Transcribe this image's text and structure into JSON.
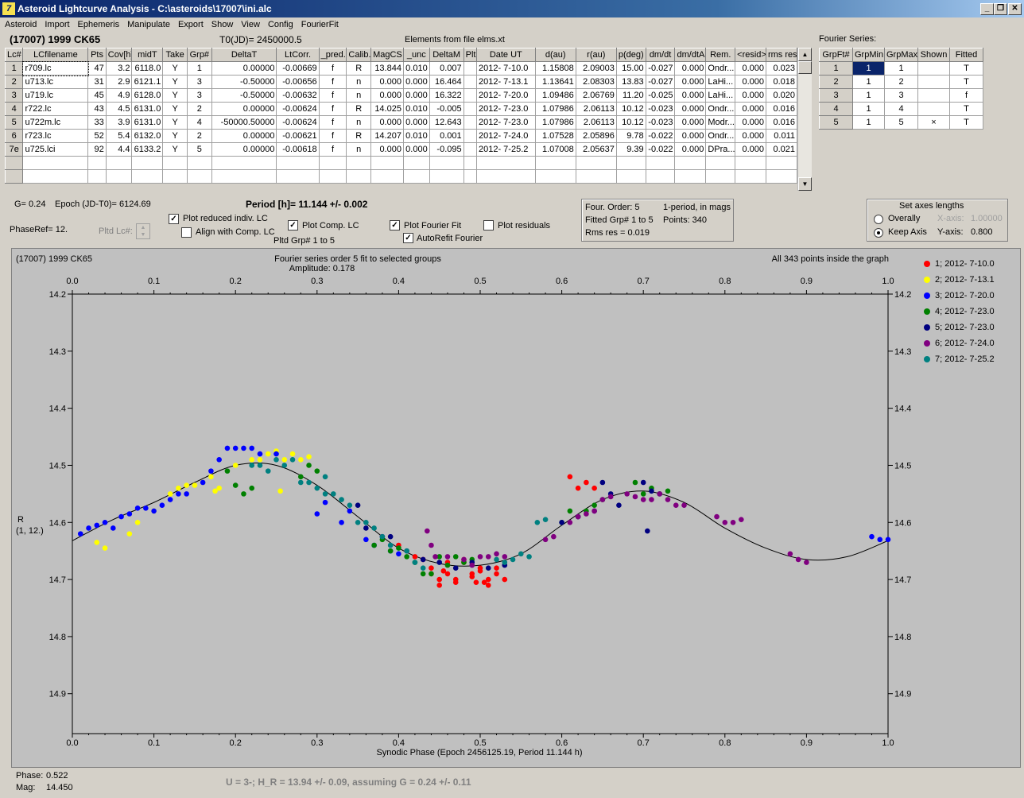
{
  "window": {
    "title": "Asteroid Lightcurve Analysis - C:\\asteroids\\17007\\ini.alc",
    "icon_name": "app-logo-icon",
    "buttons": {
      "minimize": "_",
      "restore": "❐",
      "close": "✕"
    }
  },
  "menu": [
    "Asteroid",
    "Import",
    "Ephemeris",
    "Manipulate",
    "Export",
    "Show",
    "View",
    "Config",
    "FourierFit"
  ],
  "header": {
    "asteroid": "(17007) 1999 CK65",
    "t0": "T0(JD)= 2450000.5",
    "elements": "Elements from file elms.xt",
    "fourier_series_label": "Fourier Series:"
  },
  "lc_table": {
    "columns": [
      "Lc#",
      "LCfilename",
      "Pts",
      "Cov[h]",
      "midT",
      "Take",
      "Grp#",
      "DeltaT",
      "LtCorr.",
      "_pred.",
      "Calib.",
      "MagCS",
      "_unc",
      "DeltaM",
      "Plt",
      "Date UT",
      "d(au)",
      "r(au)",
      "p(deg)",
      "dm/dt",
      "dm/dtA",
      "Rem.",
      "<resid>",
      "rms res"
    ],
    "rows": [
      [
        "1",
        "r709.lc",
        "47",
        "3.2",
        "6118.0",
        "Y",
        "1",
        "0.00000",
        "-0.00669",
        "f",
        "R",
        "13.844",
        "0.010",
        "0.007",
        "",
        "2012- 7-10.0",
        "1.15808",
        "2.09003",
        "15.00",
        "-0.027",
        "0.000",
        "Ondr...",
        "0.000",
        "0.023"
      ],
      [
        "2",
        "u713.lc",
        "31",
        "2.9",
        "6121.1",
        "Y",
        "3",
        "-0.50000",
        "-0.00656",
        "f",
        "n",
        "0.000",
        "0.000",
        "16.464",
        "",
        "2012- 7-13.1",
        "1.13641",
        "2.08303",
        "13.83",
        "-0.027",
        "0.000",
        "LaHi...",
        "0.000",
        "0.018"
      ],
      [
        "3",
        "u719.lc",
        "45",
        "4.9",
        "6128.0",
        "Y",
        "3",
        "-0.50000",
        "-0.00632",
        "f",
        "n",
        "0.000",
        "0.000",
        "16.322",
        "",
        "2012- 7-20.0",
        "1.09486",
        "2.06769",
        "11.20",
        "-0.025",
        "0.000",
        "LaHi...",
        "0.000",
        "0.020"
      ],
      [
        "4",
        "r722.lc",
        "43",
        "4.5",
        "6131.0",
        "Y",
        "2",
        "0.00000",
        "-0.00624",
        "f",
        "R",
        "14.025",
        "0.010",
        "-0.005",
        "",
        "2012- 7-23.0",
        "1.07986",
        "2.06113",
        "10.12",
        "-0.023",
        "0.000",
        "Ondr...",
        "0.000",
        "0.016"
      ],
      [
        "5",
        "u722m.lc",
        "33",
        "3.9",
        "6131.0",
        "Y",
        "4",
        "-50000.50000",
        "-0.00624",
        "f",
        "n",
        "0.000",
        "0.000",
        "12.643",
        "",
        "2012- 7-23.0",
        "1.07986",
        "2.06113",
        "10.12",
        "-0.023",
        "0.000",
        "Modr...",
        "0.000",
        "0.016"
      ],
      [
        "6",
        "r723.lc",
        "52",
        "5.4",
        "6132.0",
        "Y",
        "2",
        "0.00000",
        "-0.00621",
        "f",
        "R",
        "14.207",
        "0.010",
        "0.001",
        "",
        "2012- 7-24.0",
        "1.07528",
        "2.05896",
        "9.78",
        "-0.022",
        "0.000",
        "Ondr...",
        "0.000",
        "0.011"
      ],
      [
        "7e",
        "u725.lci",
        "92",
        "4.4",
        "6133.2",
        "Y",
        "5",
        "0.00000",
        "-0.00618",
        "f",
        "n",
        "0.000",
        "0.000",
        "-0.095",
        "",
        "2012- 7-25.2",
        "1.07008",
        "2.05637",
        "9.39",
        "-0.022",
        "0.000",
        "DPra...",
        "0.000",
        "0.021"
      ]
    ]
  },
  "fourier_table": {
    "columns": [
      "GrpFt#",
      "GrpMin",
      "GrpMax",
      "Shown",
      "Fitted"
    ],
    "rows": [
      [
        "1",
        "1",
        "1",
        "",
        "T"
      ],
      [
        "2",
        "1",
        "2",
        "",
        "T"
      ],
      [
        "3",
        "1",
        "3",
        "",
        "f"
      ],
      [
        "4",
        "1",
        "4",
        "",
        "T"
      ],
      [
        "5",
        "1",
        "5",
        "×",
        "T"
      ]
    ]
  },
  "controls": {
    "g": "G= 0.24",
    "epoch": "Epoch (JD-T0)= 6124.69",
    "period": "Period [h]= 11.144 +/- 0.002",
    "phaseref": "PhaseRef= 12.",
    "pltd_lc": "Pltd Lc#:",
    "plot_reduced": "Plot reduced indiv. LC",
    "align_comp": "Align with Comp. LC",
    "plot_comp": "Plot Comp. LC",
    "pltd_grp": "Pltd Grp#  1   to    5",
    "plot_fourier": "Plot Fourier Fit",
    "autorefit": "AutoRefit Fourier",
    "plot_residuals": "Plot residuals",
    "four_order": "Four. Order:  5",
    "one_period": "1-period, in mags",
    "fitted_grp": "Fitted Grp# 1 to 5",
    "points": "Points: 340",
    "rms": "Rms res      = 0.019",
    "axes_title": "Set axes lengths",
    "overally": "Overally",
    "keep_axis": "Keep Axis",
    "x_axis_label": "X-axis:",
    "x_axis_value": "1.00000",
    "y_axis_label": "Y-axis:",
    "y_axis_value": "0.800",
    "checked": {
      "plot_reduced": true,
      "align_comp": false,
      "plot_comp": true,
      "plot_fourier": true,
      "autorefit": true,
      "plot_residuals": false
    },
    "axes_mode": "keep_axis"
  },
  "chart_data": {
    "type": "scatter",
    "title": "(17007) 1999 CK65",
    "subtitle": "Fourier series order 5 fit to selected groups",
    "amplitude": "Amplitude: 0.178",
    "inside": "All 343 points inside the graph",
    "xlabel": "Synodic Phase (Epoch 2456125.19, Period 11.144 h)",
    "ylabel": "R",
    "ylabel2": "(1, 12.)",
    "xlim": [
      0.0,
      1.0
    ],
    "ylim": [
      14.2,
      15.0
    ],
    "x_ticks": [
      "0.0",
      "0.1",
      "0.2",
      "0.3",
      "0.4",
      "0.5",
      "0.6",
      "0.7",
      "0.8",
      "0.9",
      "1.0"
    ],
    "y_ticks": [
      "14.2",
      "14.3",
      "14.4",
      "14.5",
      "14.6",
      "14.7",
      "14.8",
      "14.9"
    ],
    "legend_position": "right",
    "fit_curve": {
      "x": [
        0.0,
        0.05,
        0.1,
        0.15,
        0.2,
        0.25,
        0.3,
        0.35,
        0.4,
        0.45,
        0.5,
        0.55,
        0.6,
        0.65,
        0.7,
        0.75,
        0.8,
        0.85,
        0.9,
        0.95,
        1.0
      ],
      "y": [
        14.632,
        14.595,
        14.565,
        14.53,
        14.5,
        14.5,
        14.535,
        14.59,
        14.645,
        14.672,
        14.675,
        14.655,
        14.605,
        14.56,
        14.545,
        14.565,
        14.61,
        14.645,
        14.665,
        14.66,
        14.632
      ]
    },
    "series": [
      {
        "name": "1; 2012- 7-10.0",
        "color": "#ff0000",
        "x": [
          0.38,
          0.4,
          0.42,
          0.44,
          0.45,
          0.46,
          0.47,
          0.48,
          0.49,
          0.5,
          0.51,
          0.52,
          0.53,
          0.46,
          0.48,
          0.5,
          0.61,
          0.62,
          0.63,
          0.64,
          0.45,
          0.49,
          0.51,
          0.44,
          0.47,
          0.52,
          0.43,
          0.455,
          0.505,
          0.495
        ],
        "y": [
          14.625,
          14.64,
          14.66,
          14.68,
          14.71,
          14.69,
          14.7,
          14.67,
          14.69,
          14.68,
          14.71,
          14.69,
          14.7,
          14.67,
          14.665,
          14.685,
          14.52,
          14.54,
          14.53,
          14.54,
          14.7,
          14.695,
          14.7,
          14.69,
          14.705,
          14.68,
          14.665,
          14.685,
          14.705,
          14.705
        ]
      },
      {
        "name": "2; 2012- 7-13.1",
        "color": "#ffff00",
        "x": [
          0.03,
          0.04,
          0.07,
          0.12,
          0.13,
          0.14,
          0.15,
          0.16,
          0.17,
          0.18,
          0.2,
          0.22,
          0.23,
          0.24,
          0.25,
          0.26,
          0.27,
          0.28,
          0.29,
          0.1,
          0.08,
          0.175,
          0.255
        ],
        "y": [
          14.635,
          14.645,
          14.62,
          14.55,
          14.54,
          14.535,
          14.535,
          14.53,
          14.52,
          14.54,
          14.5,
          14.49,
          14.49,
          14.48,
          14.475,
          14.49,
          14.48,
          14.49,
          14.485,
          14.58,
          14.6,
          14.545,
          14.545
        ]
      },
      {
        "name": "3; 2012- 7-20.0",
        "color": "#0000ff",
        "x": [
          0.01,
          0.02,
          0.03,
          0.04,
          0.05,
          0.06,
          0.07,
          0.08,
          0.09,
          0.1,
          0.11,
          0.12,
          0.13,
          0.14,
          0.17,
          0.18,
          0.19,
          0.2,
          0.21,
          0.22,
          0.23,
          0.25,
          0.3,
          0.31,
          0.33,
          0.34,
          0.36,
          0.37,
          0.38,
          0.39,
          0.4,
          0.98,
          0.99,
          1.0,
          0.16
        ],
        "y": [
          14.62,
          14.61,
          14.605,
          14.6,
          14.61,
          14.59,
          14.585,
          14.575,
          14.575,
          14.58,
          14.57,
          14.56,
          14.55,
          14.55,
          14.51,
          14.49,
          14.47,
          14.47,
          14.47,
          14.47,
          14.48,
          14.48,
          14.585,
          14.565,
          14.6,
          14.58,
          14.63,
          14.64,
          14.625,
          14.65,
          14.655,
          14.625,
          14.63,
          14.63,
          14.53
        ]
      },
      {
        "name": "4; 2012- 7-23.0",
        "color": "#008000",
        "x": [
          0.19,
          0.2,
          0.21,
          0.22,
          0.28,
          0.29,
          0.3,
          0.37,
          0.38,
          0.39,
          0.4,
          0.41,
          0.42,
          0.43,
          0.44,
          0.45,
          0.46,
          0.47,
          0.48,
          0.49,
          0.6,
          0.61,
          0.62,
          0.63,
          0.64,
          0.65,
          0.69,
          0.7,
          0.71,
          0.72,
          0.73
        ],
        "y": [
          14.51,
          14.535,
          14.55,
          14.54,
          14.52,
          14.5,
          14.51,
          14.64,
          14.63,
          14.65,
          14.645,
          14.66,
          14.67,
          14.69,
          14.69,
          14.66,
          14.675,
          14.66,
          14.67,
          14.665,
          14.6,
          14.58,
          14.59,
          14.58,
          14.57,
          14.56,
          14.53,
          14.55,
          14.54,
          14.55,
          14.545
        ]
      },
      {
        "name": "5; 2012- 7-23.0",
        "color": "#000080",
        "x": [
          0.35,
          0.36,
          0.39,
          0.41,
          0.43,
          0.45,
          0.47,
          0.49,
          0.51,
          0.53,
          0.6,
          0.62,
          0.65,
          0.66,
          0.67,
          0.7,
          0.71,
          0.72,
          0.64,
          0.705
        ],
        "y": [
          14.57,
          14.61,
          14.625,
          14.65,
          14.665,
          14.67,
          14.68,
          14.67,
          14.68,
          14.675,
          14.6,
          14.59,
          14.53,
          14.55,
          14.57,
          14.53,
          14.545,
          14.55,
          14.58,
          14.615
        ]
      },
      {
        "name": "6; 2012- 7-24.0",
        "color": "#800080",
        "x": [
          0.44,
          0.46,
          0.48,
          0.49,
          0.5,
          0.51,
          0.52,
          0.53,
          0.58,
          0.59,
          0.61,
          0.62,
          0.63,
          0.64,
          0.65,
          0.66,
          0.68,
          0.69,
          0.7,
          0.71,
          0.72,
          0.73,
          0.74,
          0.75,
          0.79,
          0.8,
          0.81,
          0.82,
          0.88,
          0.89,
          0.9,
          0.435,
          0.445
        ],
        "y": [
          14.64,
          14.66,
          14.665,
          14.675,
          14.66,
          14.66,
          14.655,
          14.66,
          14.63,
          14.625,
          14.6,
          14.59,
          14.585,
          14.58,
          14.56,
          14.555,
          14.55,
          14.555,
          14.56,
          14.56,
          14.55,
          14.56,
          14.57,
          14.57,
          14.59,
          14.6,
          14.6,
          14.595,
          14.655,
          14.665,
          14.67,
          14.615,
          14.66
        ]
      },
      {
        "name": "7; 2012- 7-25.2",
        "color": "#008080",
        "x": [
          0.23,
          0.24,
          0.25,
          0.26,
          0.27,
          0.29,
          0.3,
          0.31,
          0.32,
          0.33,
          0.34,
          0.35,
          0.36,
          0.37,
          0.38,
          0.39,
          0.41,
          0.42,
          0.43,
          0.52,
          0.53,
          0.54,
          0.55,
          0.56,
          0.57,
          0.58,
          0.22,
          0.28,
          0.31
        ],
        "y": [
          14.5,
          14.51,
          14.49,
          14.5,
          14.49,
          14.53,
          14.54,
          14.55,
          14.55,
          14.56,
          14.57,
          14.6,
          14.6,
          14.61,
          14.625,
          14.64,
          14.65,
          14.67,
          14.68,
          14.665,
          14.67,
          14.665,
          14.655,
          14.66,
          14.6,
          14.595,
          14.5,
          14.53,
          14.52
        ]
      }
    ]
  },
  "status": {
    "phase_label": "Phase:",
    "phase_value": "0.522",
    "mag_label": "Mag:",
    "mag_value": "14.450",
    "hr_text": "U = 3-; H_R = 13.94 +/- 0.09, assuming G = 0.24 +/- 0.11"
  }
}
